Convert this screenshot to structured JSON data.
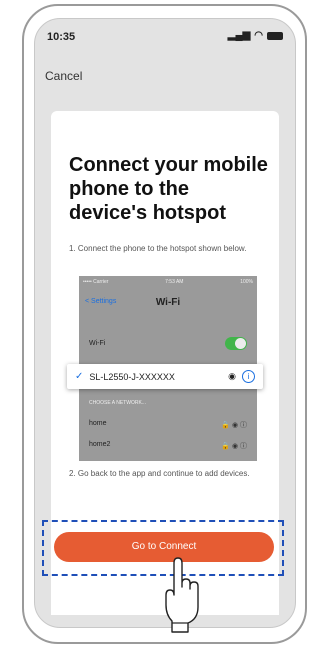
{
  "status_bar": {
    "time": "10:35",
    "signal": "signal",
    "wifi": "wifi",
    "battery": "battery"
  },
  "nav": {
    "cancel_label": "Cancel"
  },
  "content": {
    "title": "Connect your mobile phone to the device's hotspot",
    "step1": "1. Connect the phone to the hotspot shown below.",
    "step2": "2. Go back to the app and continue to add devices."
  },
  "screenshot": {
    "status_left": "••••• Carrier",
    "status_center": "7:53 AM",
    "status_right": "100%",
    "back_label": "< Settings",
    "nav_title": "Wi-Fi",
    "wifi_label": "Wi-Fi",
    "selected_network": "SL-L2550-J-XXXXXX",
    "choose_label": "CHOOSE A NETWORK...",
    "networks": [
      {
        "name": "home"
      },
      {
        "name": "home2"
      }
    ]
  },
  "button": {
    "label": "Go to Connect"
  },
  "colors": {
    "accent": "#e65c33",
    "highlight_border": "#1f4fb8",
    "ios_blue": "#1a6fe0",
    "toggle_green": "#41b54a"
  }
}
